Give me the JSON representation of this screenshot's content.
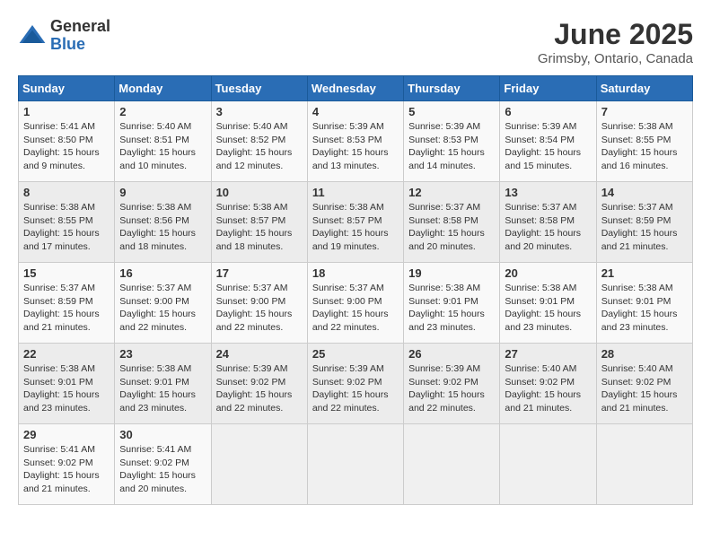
{
  "logo": {
    "general": "General",
    "blue": "Blue"
  },
  "title": {
    "month": "June 2025",
    "location": "Grimsby, Ontario, Canada"
  },
  "days_of_week": [
    "Sunday",
    "Monday",
    "Tuesday",
    "Wednesday",
    "Thursday",
    "Friday",
    "Saturday"
  ],
  "weeks": [
    [
      {
        "day": "1",
        "sunrise": "5:41 AM",
        "sunset": "8:50 PM",
        "daylight": "15 hours and 9 minutes."
      },
      {
        "day": "2",
        "sunrise": "5:40 AM",
        "sunset": "8:51 PM",
        "daylight": "15 hours and 10 minutes."
      },
      {
        "day": "3",
        "sunrise": "5:40 AM",
        "sunset": "8:52 PM",
        "daylight": "15 hours and 12 minutes."
      },
      {
        "day": "4",
        "sunrise": "5:39 AM",
        "sunset": "8:53 PM",
        "daylight": "15 hours and 13 minutes."
      },
      {
        "day": "5",
        "sunrise": "5:39 AM",
        "sunset": "8:53 PM",
        "daylight": "15 hours and 14 minutes."
      },
      {
        "day": "6",
        "sunrise": "5:39 AM",
        "sunset": "8:54 PM",
        "daylight": "15 hours and 15 minutes."
      },
      {
        "day": "7",
        "sunrise": "5:38 AM",
        "sunset": "8:55 PM",
        "daylight": "15 hours and 16 minutes."
      }
    ],
    [
      {
        "day": "8",
        "sunrise": "5:38 AM",
        "sunset": "8:55 PM",
        "daylight": "15 hours and 17 minutes."
      },
      {
        "day": "9",
        "sunrise": "5:38 AM",
        "sunset": "8:56 PM",
        "daylight": "15 hours and 18 minutes."
      },
      {
        "day": "10",
        "sunrise": "5:38 AM",
        "sunset": "8:57 PM",
        "daylight": "15 hours and 18 minutes."
      },
      {
        "day": "11",
        "sunrise": "5:38 AM",
        "sunset": "8:57 PM",
        "daylight": "15 hours and 19 minutes."
      },
      {
        "day": "12",
        "sunrise": "5:37 AM",
        "sunset": "8:58 PM",
        "daylight": "15 hours and 20 minutes."
      },
      {
        "day": "13",
        "sunrise": "5:37 AM",
        "sunset": "8:58 PM",
        "daylight": "15 hours and 20 minutes."
      },
      {
        "day": "14",
        "sunrise": "5:37 AM",
        "sunset": "8:59 PM",
        "daylight": "15 hours and 21 minutes."
      }
    ],
    [
      {
        "day": "15",
        "sunrise": "5:37 AM",
        "sunset": "8:59 PM",
        "daylight": "15 hours and 21 minutes."
      },
      {
        "day": "16",
        "sunrise": "5:37 AM",
        "sunset": "9:00 PM",
        "daylight": "15 hours and 22 minutes."
      },
      {
        "day": "17",
        "sunrise": "5:37 AM",
        "sunset": "9:00 PM",
        "daylight": "15 hours and 22 minutes."
      },
      {
        "day": "18",
        "sunrise": "5:37 AM",
        "sunset": "9:00 PM",
        "daylight": "15 hours and 22 minutes."
      },
      {
        "day": "19",
        "sunrise": "5:38 AM",
        "sunset": "9:01 PM",
        "daylight": "15 hours and 23 minutes."
      },
      {
        "day": "20",
        "sunrise": "5:38 AM",
        "sunset": "9:01 PM",
        "daylight": "15 hours and 23 minutes."
      },
      {
        "day": "21",
        "sunrise": "5:38 AM",
        "sunset": "9:01 PM",
        "daylight": "15 hours and 23 minutes."
      }
    ],
    [
      {
        "day": "22",
        "sunrise": "5:38 AM",
        "sunset": "9:01 PM",
        "daylight": "15 hours and 23 minutes."
      },
      {
        "day": "23",
        "sunrise": "5:38 AM",
        "sunset": "9:01 PM",
        "daylight": "15 hours and 23 minutes."
      },
      {
        "day": "24",
        "sunrise": "5:39 AM",
        "sunset": "9:02 PM",
        "daylight": "15 hours and 22 minutes."
      },
      {
        "day": "25",
        "sunrise": "5:39 AM",
        "sunset": "9:02 PM",
        "daylight": "15 hours and 22 minutes."
      },
      {
        "day": "26",
        "sunrise": "5:39 AM",
        "sunset": "9:02 PM",
        "daylight": "15 hours and 22 minutes."
      },
      {
        "day": "27",
        "sunrise": "5:40 AM",
        "sunset": "9:02 PM",
        "daylight": "15 hours and 21 minutes."
      },
      {
        "day": "28",
        "sunrise": "5:40 AM",
        "sunset": "9:02 PM",
        "daylight": "15 hours and 21 minutes."
      }
    ],
    [
      {
        "day": "29",
        "sunrise": "5:41 AM",
        "sunset": "9:02 PM",
        "daylight": "15 hours and 21 minutes."
      },
      {
        "day": "30",
        "sunrise": "5:41 AM",
        "sunset": "9:02 PM",
        "daylight": "15 hours and 20 minutes."
      },
      null,
      null,
      null,
      null,
      null
    ]
  ]
}
